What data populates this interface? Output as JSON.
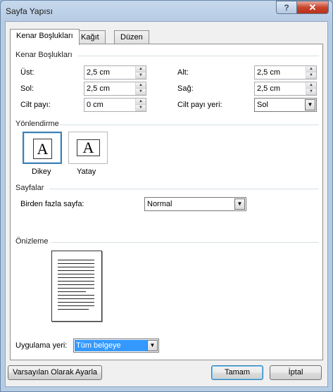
{
  "window": {
    "title": "Sayfa Yapısı",
    "help_label": "?",
    "close_label": "✕"
  },
  "tabs": [
    {
      "label": "Kenar Boşlukları",
      "active": true
    },
    {
      "label": "Kağıt",
      "active": false
    },
    {
      "label": "Düzen",
      "active": false
    }
  ],
  "margins": {
    "group_label": "Kenar Boşlukları",
    "top": {
      "label": "Üst:",
      "value": "2,5 cm"
    },
    "left": {
      "label": "Sol:",
      "value": "2,5 cm"
    },
    "gutter": {
      "label": "Cilt payı:",
      "value": "0 cm"
    },
    "bottom": {
      "label": "Alt:",
      "value": "2,5 cm"
    },
    "right": {
      "label": "Sağ:",
      "value": "2,5 cm"
    },
    "gutter_pos": {
      "label": "Cilt payı yeri:",
      "value": "Sol"
    }
  },
  "orientation": {
    "group_label": "Yönlendirme",
    "portrait_label": "Dikey",
    "landscape_label": "Yatay",
    "icon_glyph": "A",
    "selected": "portrait"
  },
  "pages": {
    "group_label": "Sayfalar",
    "multiple_label": "Birden fazla sayfa:",
    "multiple_value": "Normal"
  },
  "preview": {
    "group_label": "Önizleme"
  },
  "apply": {
    "label": "Uygulama yeri:",
    "value": "Tüm belgeye"
  },
  "buttons": {
    "default": "Varsayılan Olarak Ayarla",
    "ok": "Tamam",
    "cancel": "İptal"
  },
  "colors": {
    "selection": "#3399ff",
    "accent_border": "#3c7fb1",
    "close_button": "#c8452d"
  },
  "icons": {
    "spin_up": "▲",
    "spin_down": "▼",
    "dropdown": "▼"
  }
}
